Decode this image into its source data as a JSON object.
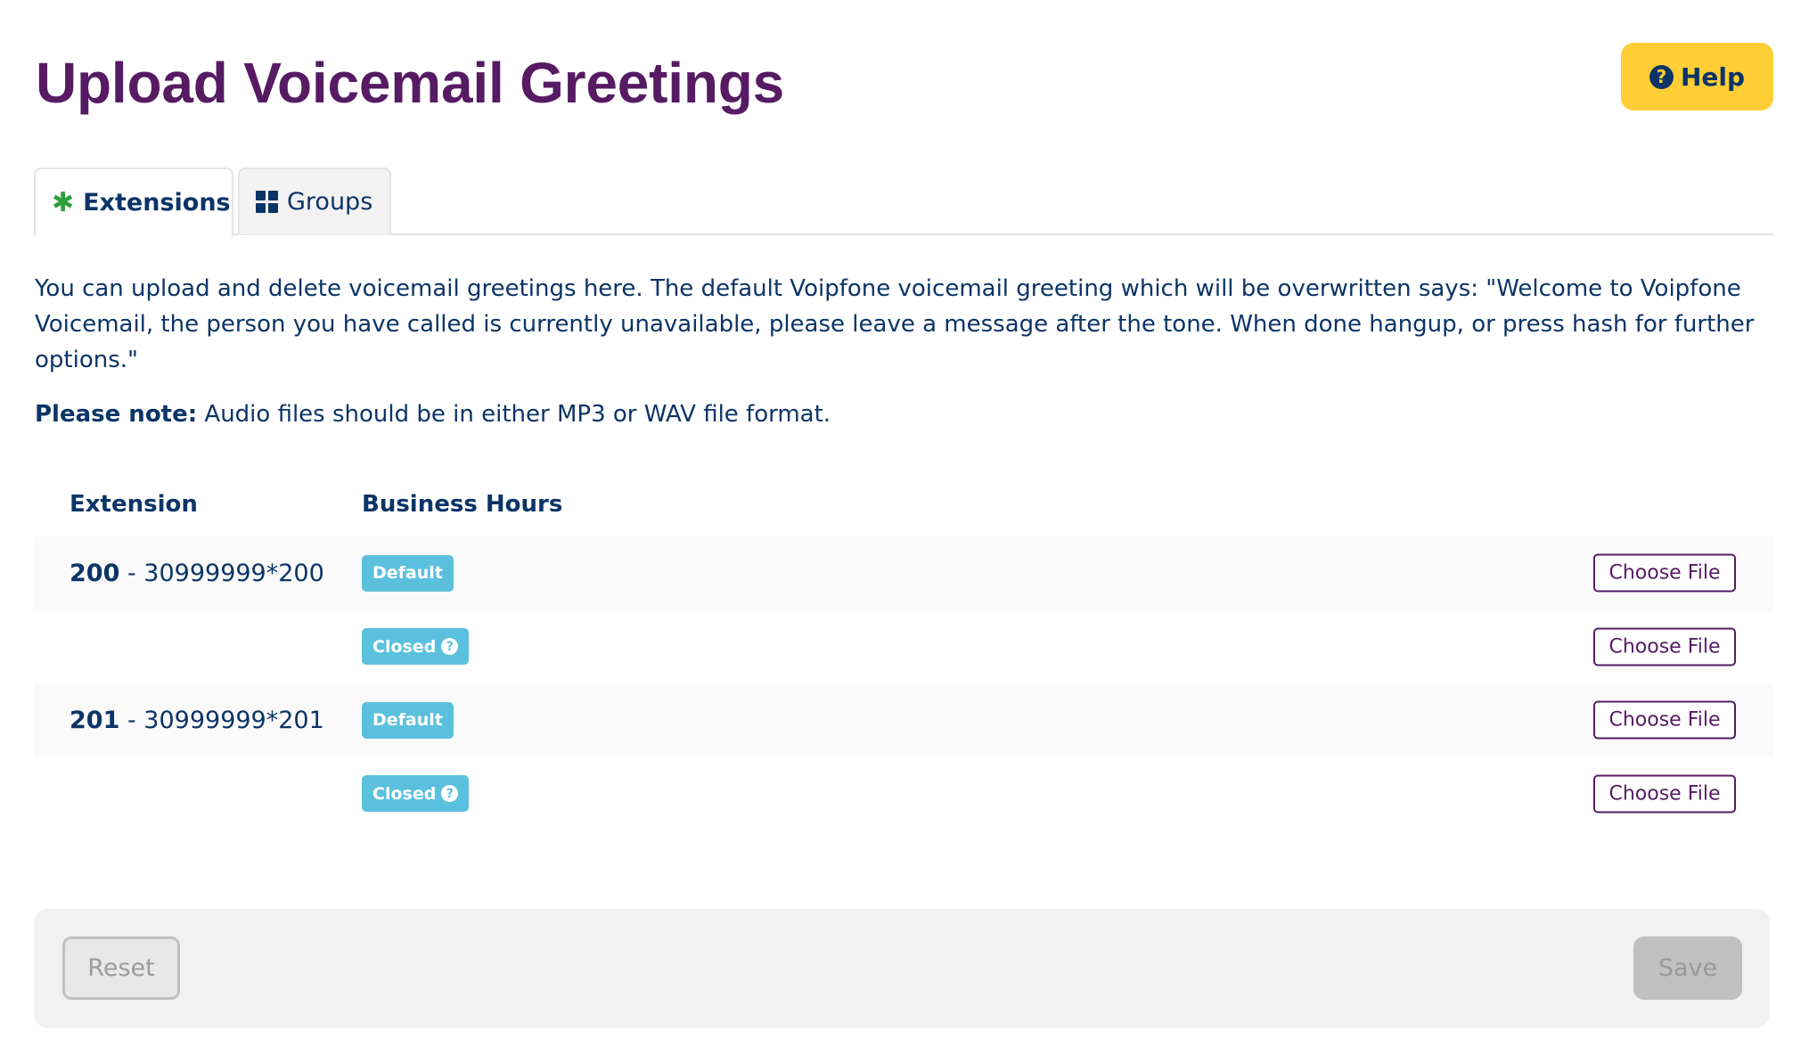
{
  "header": {
    "title": "Upload Voicemail Greetings",
    "help_label": "Help",
    "help_icon": "question-circle-icon"
  },
  "tabs": [
    {
      "label": "Extensions",
      "icon": "asterisk-icon",
      "active": true
    },
    {
      "label": "Groups",
      "icon": "grid-icon",
      "active": false
    }
  ],
  "intro": {
    "text": "You can upload and delete voicemail greetings here. The default Voipfone voicemail greeting which will be overwritten says: \"Welcome to Voipfone Voicemail, the person you have called is currently unavailable, please leave a message after the tone. When done hangup, or press hash for further options.\"",
    "note_label": "Please note:",
    "note_text": " Audio files should be in either MP3 or WAV file format."
  },
  "table": {
    "columns": [
      "Extension",
      "Business Hours"
    ],
    "rows": [
      {
        "extension": "200",
        "separator": " - ",
        "number": "30999999*200",
        "badge": "Default",
        "badge_help": false,
        "action": "Choose File"
      },
      {
        "extension": "",
        "separator": "",
        "number": "",
        "badge": "Closed",
        "badge_help": true,
        "action": "Choose File"
      },
      {
        "extension": "201",
        "separator": " - ",
        "number": "30999999*201",
        "badge": "Default",
        "badge_help": false,
        "action": "Choose File"
      },
      {
        "extension": "",
        "separator": "",
        "number": "",
        "badge": "Closed",
        "badge_help": true,
        "action": "Choose File"
      }
    ]
  },
  "footer": {
    "reset_label": "Reset",
    "save_label": "Save"
  },
  "colors": {
    "title": "#561b63",
    "text": "#0b3467",
    "help_button": "#ffcd35",
    "badge": "#5bc0de",
    "asterisk": "#2e9e3e",
    "disabled": "#c0c0c0"
  }
}
